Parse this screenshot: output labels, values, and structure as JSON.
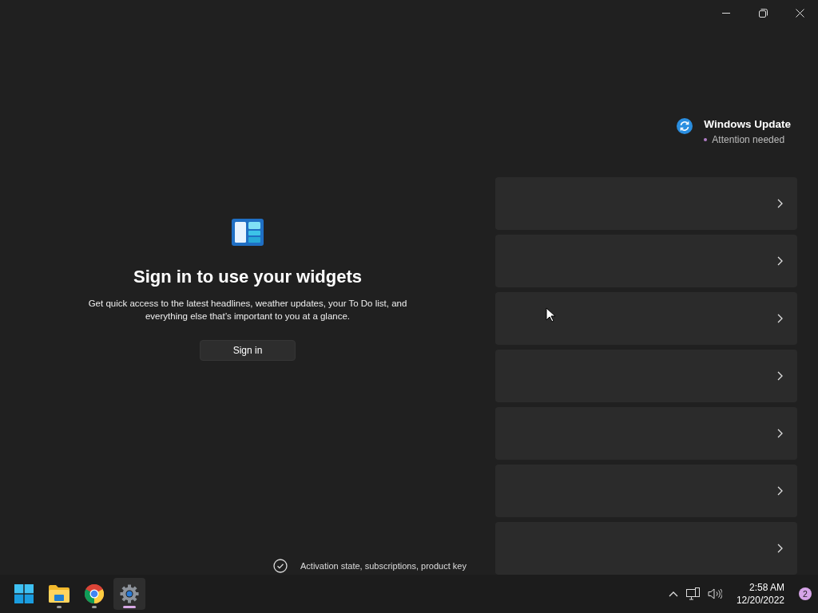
{
  "window_controls": [
    {
      "kind": "minimize"
    },
    {
      "kind": "restore"
    },
    {
      "kind": "close"
    }
  ],
  "update_status": {
    "title": "Windows Update",
    "status": "Attention needed"
  },
  "cards": [
    {
      "kind": "link"
    },
    {
      "kind": "link"
    },
    {
      "kind": "link"
    },
    {
      "kind": "link"
    },
    {
      "kind": "link"
    },
    {
      "kind": "link"
    },
    {
      "kind": "link"
    }
  ],
  "activation_row": {
    "label": "Activation state, subscriptions, product key"
  },
  "widgets": {
    "heading": "Sign in to use your widgets",
    "description": "Get quick access to the latest headlines, weather updates, your To Do list, and everything else that’s important to you at a glance.",
    "button": "Sign in"
  },
  "taskbar": {
    "apps": [
      {
        "kind": "start",
        "running": false,
        "selected": false
      },
      {
        "kind": "explorer",
        "running": true,
        "selected": false
      },
      {
        "kind": "browser",
        "running": true,
        "selected": false
      },
      {
        "kind": "settings",
        "running": true,
        "selected": true
      }
    ],
    "time": "2:58 AM",
    "date": "12/20/2022",
    "notification_count": "2"
  }
}
